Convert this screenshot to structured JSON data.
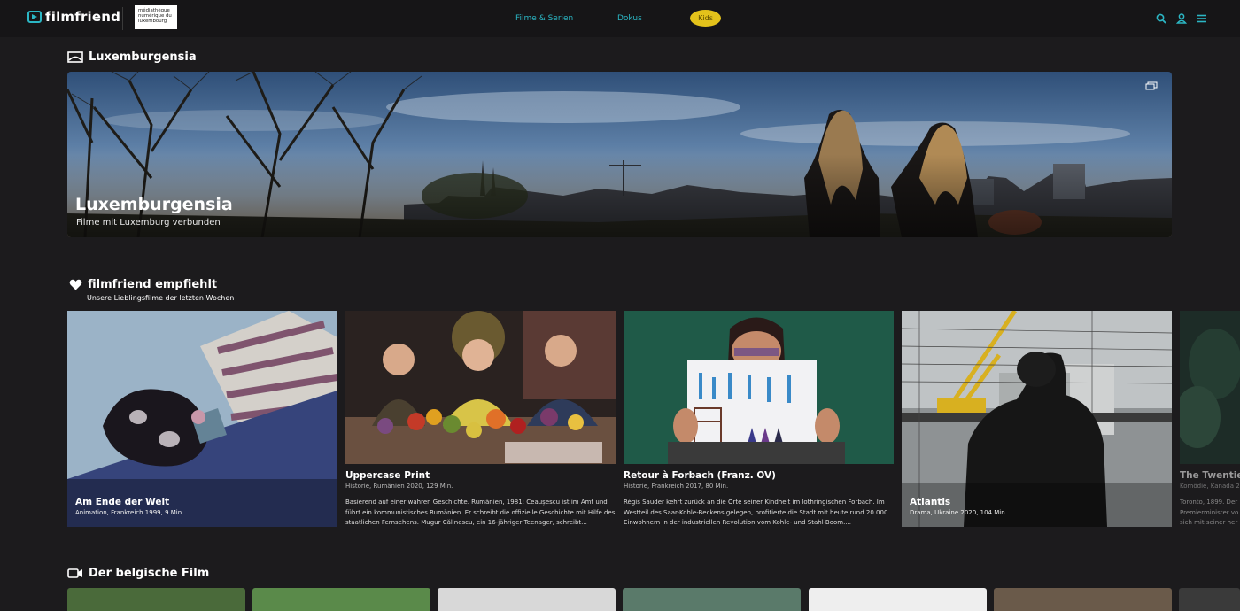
{
  "header": {
    "brand": "filmfriend",
    "partner_lines": [
      "médiathèque",
      "numérique du",
      "luxembourg"
    ],
    "nav": {
      "films": "Filme & Serien",
      "docs": "Dokus",
      "kids": "Kids"
    },
    "icons": [
      "search-icon",
      "user-icon",
      "menu-icon"
    ],
    "accent": "#2bb6c4",
    "kids_color": "#e3c21b"
  },
  "luxembourgensia": {
    "heading": "Luxemburgensia",
    "banner_title": "Luxemburgensia",
    "banner_subtitle": "Filme mit Luxemburg verbunden"
  },
  "recommended": {
    "heading": "filmfriend empfiehlt",
    "subheading": "Unsere Lieblingsfilme der letzten Wochen",
    "cards": [
      {
        "title": "Am Ende der Welt",
        "meta": "Animation, Frankreich 1999, 9 Min."
      },
      {
        "title": "Uppercase Print",
        "meta": "Historie, Rumänien 2020, 129 Min.",
        "desc": "Basierend auf einer wahren Geschichte. Rumänien, 1981: Ceaușescu ist im Amt und führt ein kommunistisches Rumänien. Er schreibt die offizielle Geschichte mit Hilfe des staatlichen Fernsehens. Mugur Călinescu, ein 16-jähriger Teenager, schreibt..."
      },
      {
        "title": "Retour à Forbach (Franz. OV)",
        "meta": "Historie, Frankreich 2017, 80 Min.",
        "desc": "Régis Sauder kehrt zurück an die Orte seiner Kindheit im lothringischen Forbach. Im Westteil des Saar-Kohle-Beckens gelegen, profitierte die Stadt mit heute rund 20.000 Einwohnern in der industriellen Revolution vom Kohle- und Stahl-Boom...."
      },
      {
        "title": "Atlantis",
        "meta": "Drama, Ukraine 2020, 104 Min."
      },
      {
        "title": "The Twentieth",
        "meta": "Komödie, Kanada 2",
        "desc": "Toronto, 1899. Der Premierminister vo sich mit seiner her"
      }
    ]
  },
  "belgian": {
    "heading": "Der belgische Film"
  }
}
